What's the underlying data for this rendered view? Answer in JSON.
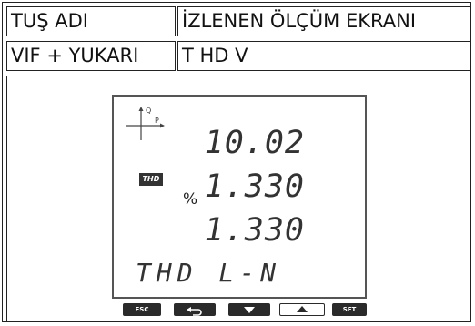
{
  "table": {
    "header": {
      "key_col": "TUŞ ADI",
      "screen_col": "İZLENEN ÖLÇÜM EKRANI"
    },
    "row": {
      "key": "VIF + YUKARI",
      "screen": "T HD V"
    }
  },
  "lcd": {
    "axis_q": "Q",
    "axis_p": "P",
    "badge": "THD",
    "unit": "%",
    "values": [
      "10.02",
      "1.330",
      "1.330"
    ],
    "mode": "THD L-N"
  },
  "buttons": {
    "esc": "ESC",
    "back": "back-arrow-icon",
    "down": "down-triangle-icon",
    "up": "up-triangle-icon",
    "set": "SET"
  }
}
